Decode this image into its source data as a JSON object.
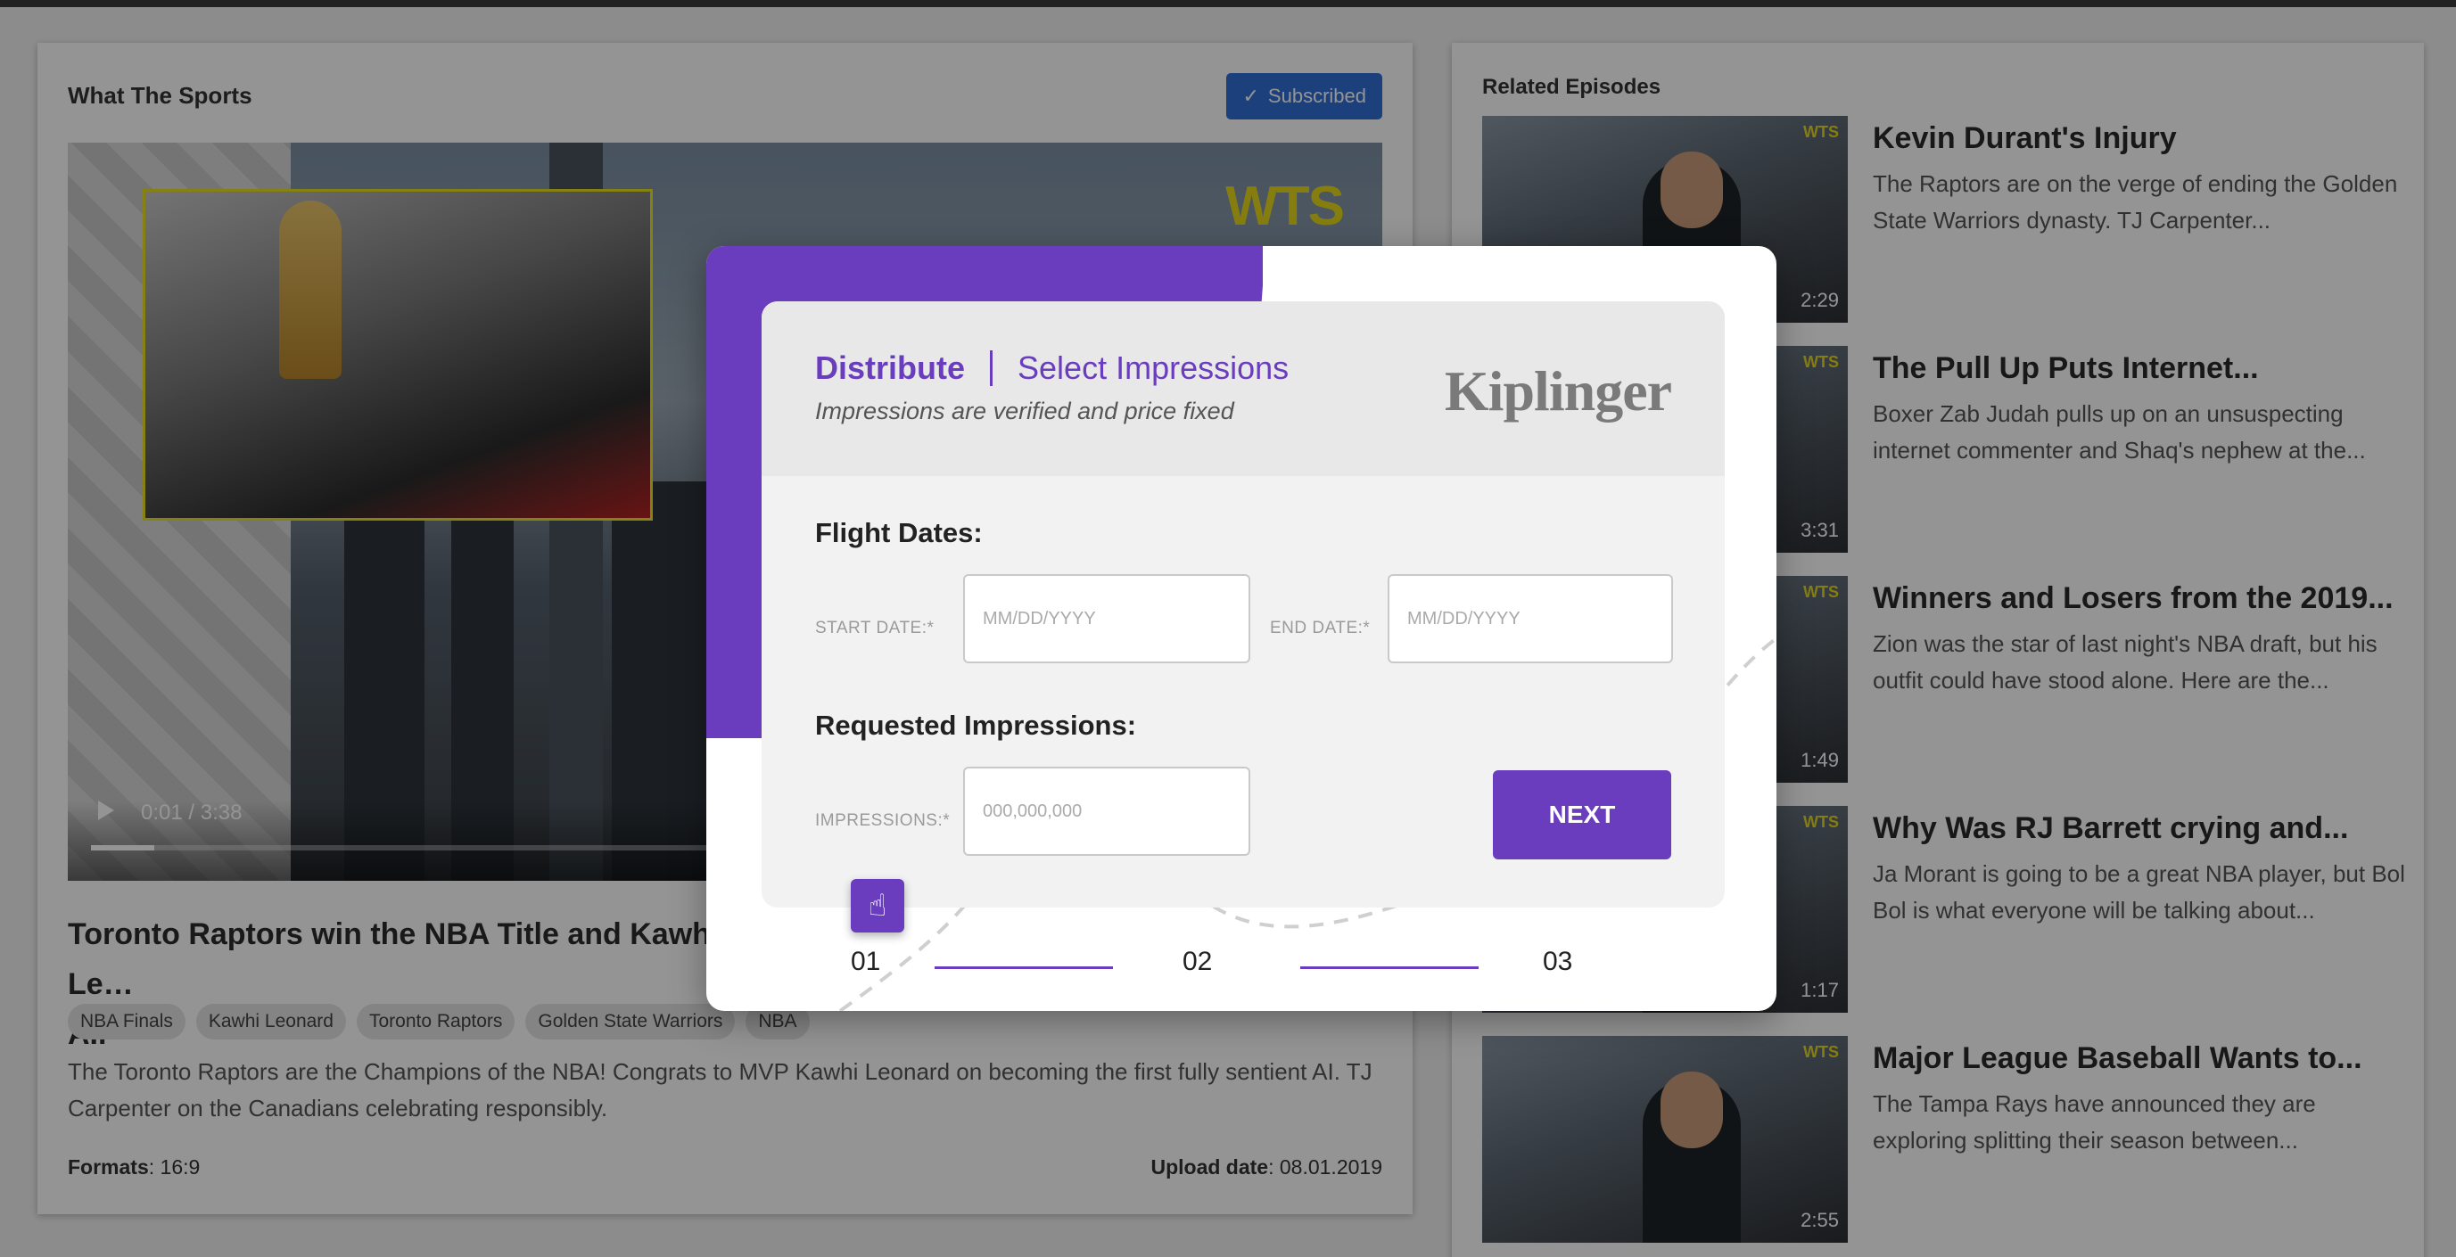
{
  "show": {
    "title": "What The Sports",
    "subscribe_label": "Subscribed"
  },
  "video": {
    "brand": "WTS",
    "time": "0:01 / 3:38",
    "progress": 0.05
  },
  "episode": {
    "title": "Toronto Raptors win the NBA Title and Kawhi Le…",
    "title_line2": "AI.",
    "tags": [
      "NBA Finals",
      "Kawhi Leonard",
      "Toronto Raptors",
      "Golden State Warriors",
      "NBA"
    ],
    "description": "The Toronto Raptors are the Champions of the NBA! Congrats to MVP Kawhi Leonard on becoming the first fully sentient AI. TJ Carpenter on the Canadians celebrating responsibly.",
    "formats_label": "Formats",
    "formats_value": ": 16:9",
    "upload_label": "Upload date",
    "upload_value": ": 08.01.2019"
  },
  "related": {
    "title": "Related Episodes",
    "items": [
      {
        "title": "Kevin Durant's Injury",
        "description": "The Raptors are on the verge of ending the Golden State Warriors dynasty. TJ Carpenter...",
        "duration": "2:29",
        "brand": "WTS"
      },
      {
        "title": "The Pull Up Puts Internet...",
        "description": "Boxer Zab Judah pulls up on an unsuspecting internet commenter and Shaq's nephew at the...",
        "duration": "3:31",
        "brand": "WTS"
      },
      {
        "title": "Winners and Losers from the 2019...",
        "description": "Zion was the star of last night's NBA draft, but his outfit could have stood alone. Here are the...",
        "duration": "1:49",
        "brand": "WTS"
      },
      {
        "title": "Why Was RJ Barrett crying and...",
        "description": "Ja Morant is going to be a great NBA player, but Bol Bol is what everyone will be talking about...",
        "duration": "1:17",
        "brand": "WTS"
      },
      {
        "title": "Major League Baseball Wants to...",
        "description": "The Tampa Rays have announced they are exploring splitting their season between...",
        "duration": "2:55",
        "brand": "WTS"
      }
    ]
  },
  "modal": {
    "crumb_primary": "Distribute",
    "crumb_secondary": "Select Impressions",
    "subtitle": "Impressions are verified and price fixed",
    "logo": "Kiplinger",
    "flight_dates_label": "Flight Dates:",
    "start_date_label": "START DATE:*",
    "start_date_placeholder": "MM/DD/YYYY",
    "end_date_label": "END DATE:*",
    "end_date_placeholder": "MM/DD/YYYY",
    "impressions_section_label": "Requested Impressions:",
    "impressions_label": "IMPRESSIONS:*",
    "impressions_placeholder": "000,000,000",
    "next_label": "NEXT",
    "steps": [
      "01",
      "02",
      "03"
    ],
    "accent_color": "#6a3cbe"
  }
}
